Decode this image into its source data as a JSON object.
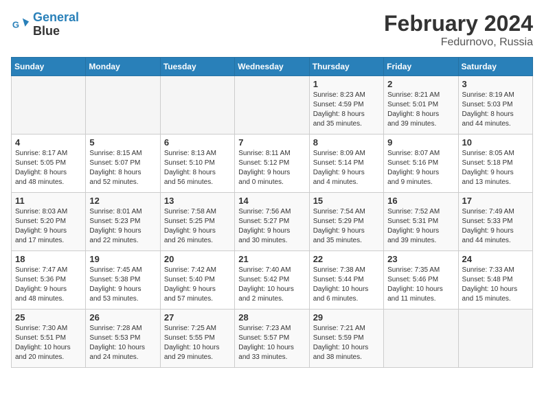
{
  "header": {
    "logo_line1": "General",
    "logo_line2": "Blue",
    "month_title": "February 2024",
    "location": "Fedurnovo, Russia"
  },
  "days_of_week": [
    "Sunday",
    "Monday",
    "Tuesday",
    "Wednesday",
    "Thursday",
    "Friday",
    "Saturday"
  ],
  "weeks": [
    [
      {
        "day": "",
        "content": ""
      },
      {
        "day": "",
        "content": ""
      },
      {
        "day": "",
        "content": ""
      },
      {
        "day": "",
        "content": ""
      },
      {
        "day": "1",
        "content": "Sunrise: 8:23 AM\nSunset: 4:59 PM\nDaylight: 8 hours\nand 35 minutes."
      },
      {
        "day": "2",
        "content": "Sunrise: 8:21 AM\nSunset: 5:01 PM\nDaylight: 8 hours\nand 39 minutes."
      },
      {
        "day": "3",
        "content": "Sunrise: 8:19 AM\nSunset: 5:03 PM\nDaylight: 8 hours\nand 44 minutes."
      }
    ],
    [
      {
        "day": "4",
        "content": "Sunrise: 8:17 AM\nSunset: 5:05 PM\nDaylight: 8 hours\nand 48 minutes."
      },
      {
        "day": "5",
        "content": "Sunrise: 8:15 AM\nSunset: 5:07 PM\nDaylight: 8 hours\nand 52 minutes."
      },
      {
        "day": "6",
        "content": "Sunrise: 8:13 AM\nSunset: 5:10 PM\nDaylight: 8 hours\nand 56 minutes."
      },
      {
        "day": "7",
        "content": "Sunrise: 8:11 AM\nSunset: 5:12 PM\nDaylight: 9 hours\nand 0 minutes."
      },
      {
        "day": "8",
        "content": "Sunrise: 8:09 AM\nSunset: 5:14 PM\nDaylight: 9 hours\nand 4 minutes."
      },
      {
        "day": "9",
        "content": "Sunrise: 8:07 AM\nSunset: 5:16 PM\nDaylight: 9 hours\nand 9 minutes."
      },
      {
        "day": "10",
        "content": "Sunrise: 8:05 AM\nSunset: 5:18 PM\nDaylight: 9 hours\nand 13 minutes."
      }
    ],
    [
      {
        "day": "11",
        "content": "Sunrise: 8:03 AM\nSunset: 5:20 PM\nDaylight: 9 hours\nand 17 minutes."
      },
      {
        "day": "12",
        "content": "Sunrise: 8:01 AM\nSunset: 5:23 PM\nDaylight: 9 hours\nand 22 minutes."
      },
      {
        "day": "13",
        "content": "Sunrise: 7:58 AM\nSunset: 5:25 PM\nDaylight: 9 hours\nand 26 minutes."
      },
      {
        "day": "14",
        "content": "Sunrise: 7:56 AM\nSunset: 5:27 PM\nDaylight: 9 hours\nand 30 minutes."
      },
      {
        "day": "15",
        "content": "Sunrise: 7:54 AM\nSunset: 5:29 PM\nDaylight: 9 hours\nand 35 minutes."
      },
      {
        "day": "16",
        "content": "Sunrise: 7:52 AM\nSunset: 5:31 PM\nDaylight: 9 hours\nand 39 minutes."
      },
      {
        "day": "17",
        "content": "Sunrise: 7:49 AM\nSunset: 5:33 PM\nDaylight: 9 hours\nand 44 minutes."
      }
    ],
    [
      {
        "day": "18",
        "content": "Sunrise: 7:47 AM\nSunset: 5:36 PM\nDaylight: 9 hours\nand 48 minutes."
      },
      {
        "day": "19",
        "content": "Sunrise: 7:45 AM\nSunset: 5:38 PM\nDaylight: 9 hours\nand 53 minutes."
      },
      {
        "day": "20",
        "content": "Sunrise: 7:42 AM\nSunset: 5:40 PM\nDaylight: 9 hours\nand 57 minutes."
      },
      {
        "day": "21",
        "content": "Sunrise: 7:40 AM\nSunset: 5:42 PM\nDaylight: 10 hours\nand 2 minutes."
      },
      {
        "day": "22",
        "content": "Sunrise: 7:38 AM\nSunset: 5:44 PM\nDaylight: 10 hours\nand 6 minutes."
      },
      {
        "day": "23",
        "content": "Sunrise: 7:35 AM\nSunset: 5:46 PM\nDaylight: 10 hours\nand 11 minutes."
      },
      {
        "day": "24",
        "content": "Sunrise: 7:33 AM\nSunset: 5:48 PM\nDaylight: 10 hours\nand 15 minutes."
      }
    ],
    [
      {
        "day": "25",
        "content": "Sunrise: 7:30 AM\nSunset: 5:51 PM\nDaylight: 10 hours\nand 20 minutes."
      },
      {
        "day": "26",
        "content": "Sunrise: 7:28 AM\nSunset: 5:53 PM\nDaylight: 10 hours\nand 24 minutes."
      },
      {
        "day": "27",
        "content": "Sunrise: 7:25 AM\nSunset: 5:55 PM\nDaylight: 10 hours\nand 29 minutes."
      },
      {
        "day": "28",
        "content": "Sunrise: 7:23 AM\nSunset: 5:57 PM\nDaylight: 10 hours\nand 33 minutes."
      },
      {
        "day": "29",
        "content": "Sunrise: 7:21 AM\nSunset: 5:59 PM\nDaylight: 10 hours\nand 38 minutes."
      },
      {
        "day": "",
        "content": ""
      },
      {
        "day": "",
        "content": ""
      }
    ]
  ]
}
